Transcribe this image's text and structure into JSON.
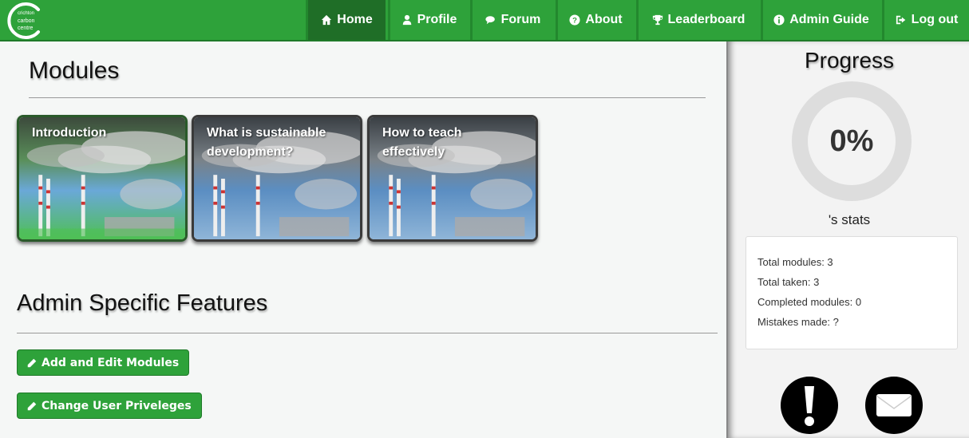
{
  "brand": {
    "logo_text_1": "crichton",
    "logo_text_2": "carbon",
    "logo_text_3": "centre"
  },
  "nav": [
    {
      "label": "Home",
      "icon": "home-icon",
      "active": true
    },
    {
      "label": "Profile",
      "icon": "user-icon"
    },
    {
      "label": "Forum",
      "icon": "comments-icon"
    },
    {
      "label": "About",
      "icon": "question-circle-icon"
    },
    {
      "label": "Leaderboard",
      "icon": "trophy-icon"
    },
    {
      "label": "Admin Guide",
      "icon": "info-circle-icon"
    },
    {
      "label": "Log out",
      "icon": "sign-out-icon"
    }
  ],
  "modules": {
    "heading": "Modules",
    "cards": [
      {
        "title": "Introduction",
        "active": true
      },
      {
        "title": "What is sustainable development?"
      },
      {
        "title": "How to teach effectively"
      }
    ]
  },
  "admin": {
    "heading": "Admin Specific Features",
    "add_edit_label": "Add and Edit Modules",
    "change_privileges_label": "Change User Priveleges"
  },
  "sidebar": {
    "progress_title": "Progress",
    "progress_value": 0,
    "progress_label": "0%",
    "stats_label": "'s stats",
    "stats": [
      "Total modules: 3",
      "Total taken: 3",
      "Completed modules: 0",
      "Mistakes made: ?"
    ]
  },
  "colors": {
    "accent": "#2ea23a",
    "accent_dark": "#1f6e27",
    "ring": "#dddddd"
  }
}
